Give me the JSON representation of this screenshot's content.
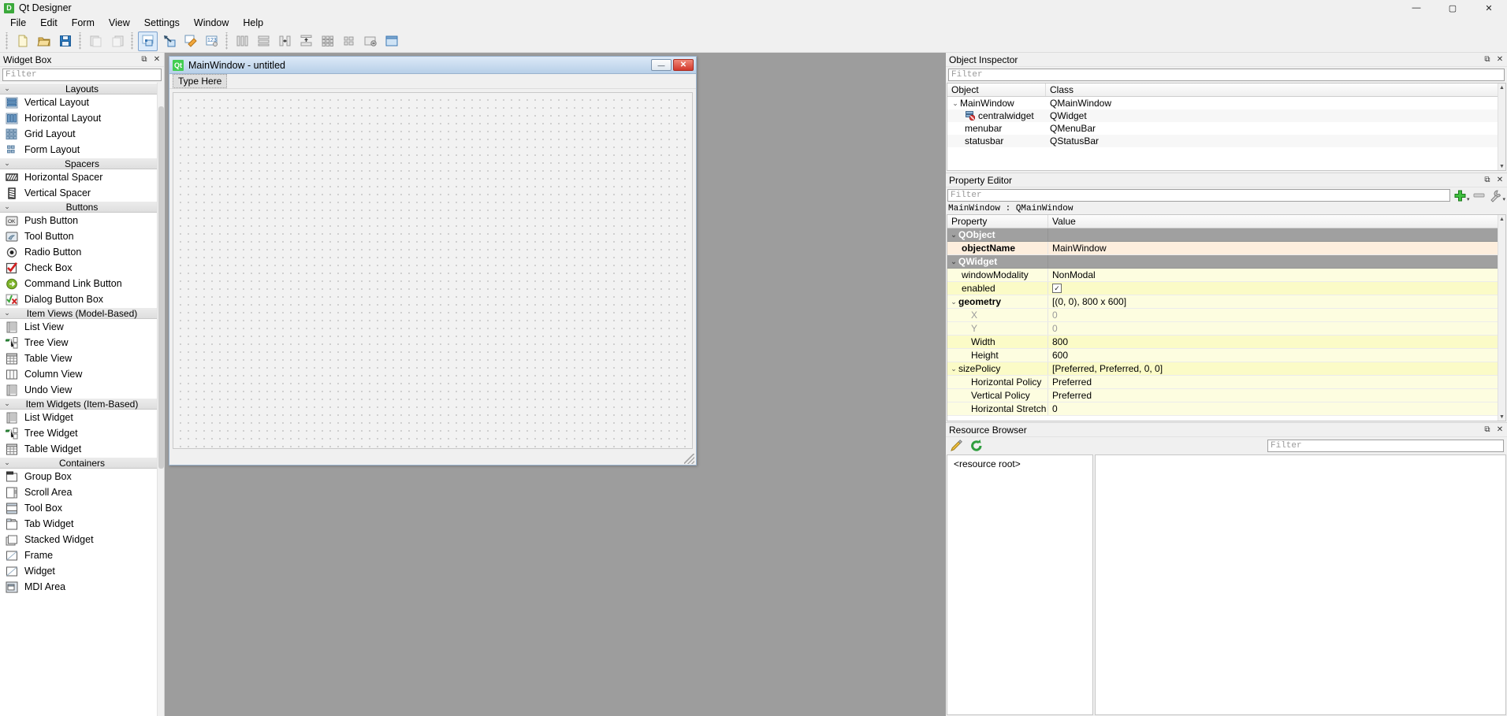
{
  "app": {
    "title": "Qt Designer",
    "icon": "qt-designer-icon"
  },
  "window_controls": {
    "minimize": "—",
    "maximize": "▢",
    "close": "✕"
  },
  "menubar": {
    "items": [
      {
        "label": "File",
        "mnemonic": "F"
      },
      {
        "label": "Edit",
        "mnemonic": "E"
      },
      {
        "label": "Form",
        "mnemonic": "o"
      },
      {
        "label": "View",
        "mnemonic": "V"
      },
      {
        "label": "Settings",
        "mnemonic": "S"
      },
      {
        "label": "Window",
        "mnemonic": "W"
      },
      {
        "label": "Help",
        "mnemonic": "H"
      }
    ]
  },
  "toolbar": {
    "groups": [
      [
        "new-form-icon",
        "open-form-icon",
        "save-form-icon"
      ],
      [
        "undo-icon",
        "redo-icon"
      ],
      [
        "edit-widgets-icon",
        "edit-signals-slots-icon",
        "edit-buddies-icon",
        "edit-tab-order-icon"
      ],
      [
        "layout-horizontally-icon",
        "layout-vertically-icon",
        "layout-in-splitter-horizontal-icon",
        "layout-in-splitter-vertical-icon",
        "layout-in-grid-icon",
        "layout-in-form-icon",
        "break-layout-icon",
        "adjust-size-icon"
      ]
    ]
  },
  "widget_box": {
    "title": "Widget Box",
    "filter_placeholder": "Filter",
    "float_button": "⧉",
    "close_button": "✕",
    "groups": [
      {
        "name": "Layouts",
        "expanded": true,
        "items": [
          {
            "label": "Vertical Layout",
            "icon": "vertical-layout-icon"
          },
          {
            "label": "Horizontal Layout",
            "icon": "horizontal-layout-icon"
          },
          {
            "label": "Grid Layout",
            "icon": "grid-layout-icon"
          },
          {
            "label": "Form Layout",
            "icon": "form-layout-icon"
          }
        ]
      },
      {
        "name": "Spacers",
        "expanded": true,
        "items": [
          {
            "label": "Horizontal Spacer",
            "icon": "horizontal-spacer-icon"
          },
          {
            "label": "Vertical Spacer",
            "icon": "vertical-spacer-icon"
          }
        ]
      },
      {
        "name": "Buttons",
        "expanded": true,
        "items": [
          {
            "label": "Push Button",
            "icon": "push-button-icon"
          },
          {
            "label": "Tool Button",
            "icon": "tool-button-icon"
          },
          {
            "label": "Radio Button",
            "icon": "radio-button-icon"
          },
          {
            "label": "Check Box",
            "icon": "check-box-icon"
          },
          {
            "label": "Command Link Button",
            "icon": "command-link-button-icon"
          },
          {
            "label": "Dialog Button Box",
            "icon": "dialog-button-box-icon"
          }
        ]
      },
      {
        "name": "Item Views (Model-Based)",
        "expanded": true,
        "items": [
          {
            "label": "List View",
            "icon": "list-view-icon"
          },
          {
            "label": "Tree View",
            "icon": "tree-view-icon"
          },
          {
            "label": "Table View",
            "icon": "table-view-icon"
          },
          {
            "label": "Column View",
            "icon": "column-view-icon"
          },
          {
            "label": "Undo View",
            "icon": "undo-view-icon"
          }
        ]
      },
      {
        "name": "Item Widgets (Item-Based)",
        "expanded": true,
        "items": [
          {
            "label": "List Widget",
            "icon": "list-widget-icon"
          },
          {
            "label": "Tree Widget",
            "icon": "tree-widget-icon"
          },
          {
            "label": "Table Widget",
            "icon": "table-widget-icon"
          }
        ]
      },
      {
        "name": "Containers",
        "expanded": true,
        "items": [
          {
            "label": "Group Box",
            "icon": "group-box-icon"
          },
          {
            "label": "Scroll Area",
            "icon": "scroll-area-icon"
          },
          {
            "label": "Tool Box",
            "icon": "tool-box-icon"
          },
          {
            "label": "Tab Widget",
            "icon": "tab-widget-icon"
          },
          {
            "label": "Stacked Widget",
            "icon": "stacked-widget-icon"
          },
          {
            "label": "Frame",
            "icon": "frame-icon"
          },
          {
            "label": "Widget",
            "icon": "widget-icon"
          },
          {
            "label": "MDI Area",
            "icon": "mdi-area-icon"
          }
        ]
      }
    ]
  },
  "form_window": {
    "title": "MainWindow - untitled",
    "icon": "qt-logo-icon",
    "menu_placeholder": "Type Here",
    "controls": {
      "minimize": "—",
      "close": "✕"
    }
  },
  "object_inspector": {
    "title": "Object Inspector",
    "filter_placeholder": "Filter",
    "float_button": "⧉",
    "close_button": "✕",
    "columns": [
      "Object",
      "Class"
    ],
    "rows": [
      {
        "object": "MainWindow",
        "class": "QMainWindow",
        "depth": 0,
        "expanded": true,
        "icon": ""
      },
      {
        "object": "centralwidget",
        "class": "QWidget",
        "depth": 1,
        "expanded": false,
        "icon": "central-widget-icon"
      },
      {
        "object": "menubar",
        "class": "QMenuBar",
        "depth": 1,
        "expanded": false,
        "icon": ""
      },
      {
        "object": "statusbar",
        "class": "QStatusBar",
        "depth": 1,
        "expanded": false,
        "icon": ""
      }
    ]
  },
  "property_editor": {
    "title": "Property Editor",
    "filter_placeholder": "Filter",
    "float_button": "⧉",
    "close_button": "✕",
    "add_button": "add-dynamic-property-icon",
    "remove_button": "remove-dynamic-property-icon",
    "configure_button": "configure-property-editor-icon",
    "object_line": "MainWindow : QMainWindow",
    "columns": [
      "Property",
      "Value"
    ],
    "rows": [
      {
        "name": "QObject",
        "value": "",
        "kind": "group",
        "indent": 0,
        "expanded": true
      },
      {
        "name": "objectName",
        "value": "MainWindow",
        "kind": "highlight",
        "indent": 0,
        "bold": true
      },
      {
        "name": "QWidget",
        "value": "",
        "kind": "group",
        "indent": 0,
        "expanded": true
      },
      {
        "name": "windowModality",
        "value": "NonModal",
        "kind": "yellow1",
        "indent": 0
      },
      {
        "name": "enabled",
        "value": "checkbox-checked",
        "kind": "yellow2",
        "indent": 0
      },
      {
        "name": "geometry",
        "value": "[(0, 0), 800 x 600]",
        "kind": "yellow1",
        "indent": 0,
        "bold": true,
        "expanded": true
      },
      {
        "name": "X",
        "value": "0",
        "kind": "yellow1",
        "indent": 1,
        "dim": true
      },
      {
        "name": "Y",
        "value": "0",
        "kind": "yellow1",
        "indent": 1,
        "dim": true
      },
      {
        "name": "Width",
        "value": "800",
        "kind": "yellow2",
        "indent": 1
      },
      {
        "name": "Height",
        "value": "600",
        "kind": "yellow1",
        "indent": 1
      },
      {
        "name": "sizePolicy",
        "value": "[Preferred, Preferred, 0, 0]",
        "kind": "yellow2",
        "indent": 0,
        "expanded": true
      },
      {
        "name": "Horizontal Policy",
        "value": "Preferred",
        "kind": "yellow1",
        "indent": 1
      },
      {
        "name": "Vertical Policy",
        "value": "Preferred",
        "kind": "yellow1",
        "indent": 1
      },
      {
        "name": "Horizontal Stretch",
        "value": "0",
        "kind": "yellow1",
        "indent": 1
      }
    ]
  },
  "resource_browser": {
    "title": "Resource Browser",
    "float_button": "⧉",
    "close_button": "✕",
    "edit_button": "edit-resources-icon",
    "reload_button": "reload-icon",
    "filter_placeholder": "Filter",
    "tree_root": "<resource root>"
  },
  "colors": {
    "accent_blue": "#b7cfe8",
    "canvas_gray": "#9d9d9d",
    "group_gray": "#a0a0a0",
    "prop_yellow": "#fbfbc7",
    "prop_highlight": "#fdeedd",
    "qt_green": "#41cd52",
    "close_red": "#d2382c"
  }
}
